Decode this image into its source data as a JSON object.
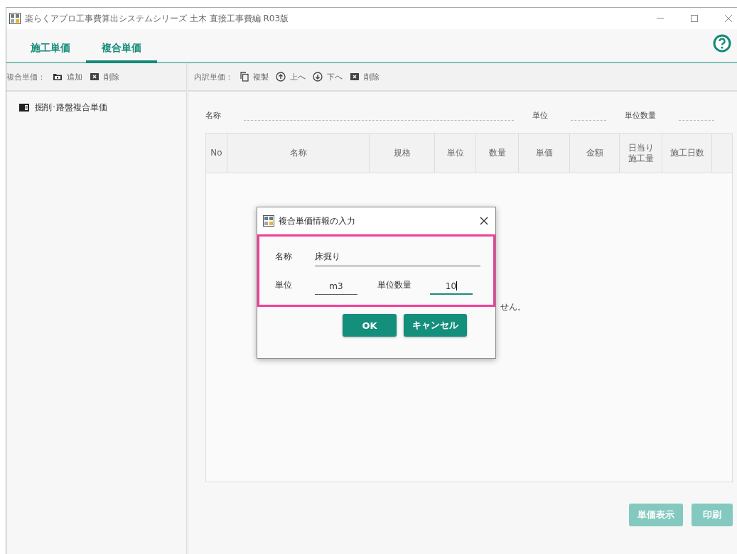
{
  "window": {
    "title": "楽らくアプロ工事費算出システムシリーズ 土木  直接工事費編  R03版"
  },
  "tabs": [
    {
      "label": "施工単価",
      "selected": false
    },
    {
      "label": "複合単価",
      "selected": true
    }
  ],
  "left_toolbar": {
    "label": "複合単価：",
    "actions": [
      {
        "kind": "add",
        "label": "追加"
      },
      {
        "kind": "delete",
        "label": "削除"
      }
    ]
  },
  "tree": [
    {
      "label": "掘削･路盤複合単価",
      "selected": false
    }
  ],
  "right_toolbar": {
    "label": "内訳単価：",
    "actions": [
      {
        "kind": "copy",
        "label": "複製"
      },
      {
        "kind": "up",
        "label": "上へ"
      },
      {
        "kind": "down",
        "label": "下へ"
      },
      {
        "kind": "delete",
        "label": "削除"
      }
    ]
  },
  "header_fields": [
    {
      "label": "名称"
    },
    {
      "label": "単位"
    },
    {
      "label": "単位数量"
    }
  ],
  "table": {
    "columns": [
      "No",
      "名称",
      "規格",
      "単位",
      "数量",
      "単価",
      "金額",
      "日当り施工量",
      "施工日数"
    ],
    "empty_message": "せん。"
  },
  "bottom_buttons": [
    {
      "label": "単価表示",
      "disabled": true
    },
    {
      "label": "印刷",
      "disabled": true
    }
  ],
  "dialog": {
    "title": "複合単価情報の入力",
    "fields": [
      {
        "label": "名称",
        "value": "床掘り",
        "focused": false
      },
      {
        "label": "単位",
        "value": "m3",
        "focused": false
      },
      {
        "label": "単位数量",
        "value": "10",
        "focused": true
      }
    ],
    "buttons": [
      "OK",
      "キャンセル"
    ]
  }
}
